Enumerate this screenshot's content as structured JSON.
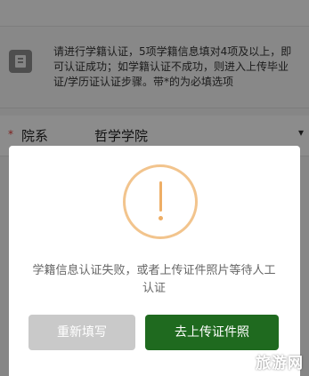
{
  "notice": {
    "text": "请进行学籍认证，5项学籍信息填对4项及以上，即可认证成功；如学籍认证不成功，则进入上传毕业证/学历证认证步骤。带*的为必填选项"
  },
  "form": {
    "department": {
      "required_mark": "*",
      "label": "院系",
      "value": "哲学学院",
      "caret": "▾"
    }
  },
  "dialog": {
    "message": "学籍信息认证失败，或者上传证件照片等待人工认证",
    "refill_button": "重新填写",
    "upload_button": "去上传证件照",
    "icon": "alert-circle-icon",
    "colors": {
      "icon": "#eeae66",
      "upload_button": "#1f6a1f",
      "refill_button": "#c9c9c9"
    }
  },
  "watermark": {
    "text": "旅游网"
  }
}
